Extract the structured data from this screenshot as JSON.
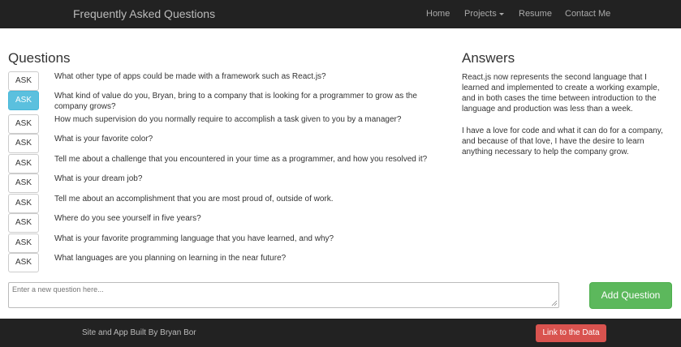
{
  "navbar": {
    "brand": "Frequently Asked Questions",
    "items": [
      "Home",
      "Projects",
      "Resume",
      "Contact Me"
    ]
  },
  "questions": {
    "heading": "Questions",
    "ask_label": "ASK",
    "active_index": 1,
    "items": [
      "What other type of apps could be made with a framework such as React.js?",
      "What kind of value do you, Bryan, bring to a company that is looking for a programmer to grow as the company grows?",
      "How much supervision do you normally require to accomplish a task given to you by a manager?",
      "What is your favorite color?",
      "Tell me about a challenge that you encountered in your time as a programmer, and how you resolved it?",
      "What is your dream job?",
      "Tell me about an accomplishment that you are most proud of, outside of work.",
      "Where do you see yourself in five years?",
      "What is your favorite programming language that you have learned, and why?",
      "What languages are you planning on learning in the near future?"
    ]
  },
  "answers": {
    "heading": "Answers",
    "paragraphs": [
      "React.js now represents the second language that I learned and implemented to create a working example, and in both cases the time between introduction to the language and production was less than a week.",
      "I have a love for code and what it can do for a company, and because of that love, I have the desire to learn anything necessary to help the company grow."
    ]
  },
  "new_question": {
    "placeholder": "Enter a new question here...",
    "button": "Add Question"
  },
  "footer": {
    "credit": "Site and App Built By Bryan Bor",
    "data_button": "Link to the Data"
  },
  "colors": {
    "navbar": "#222222",
    "active_ask": "#5bc0de",
    "add_button": "#5cb85c",
    "data_button": "#d9534f"
  }
}
